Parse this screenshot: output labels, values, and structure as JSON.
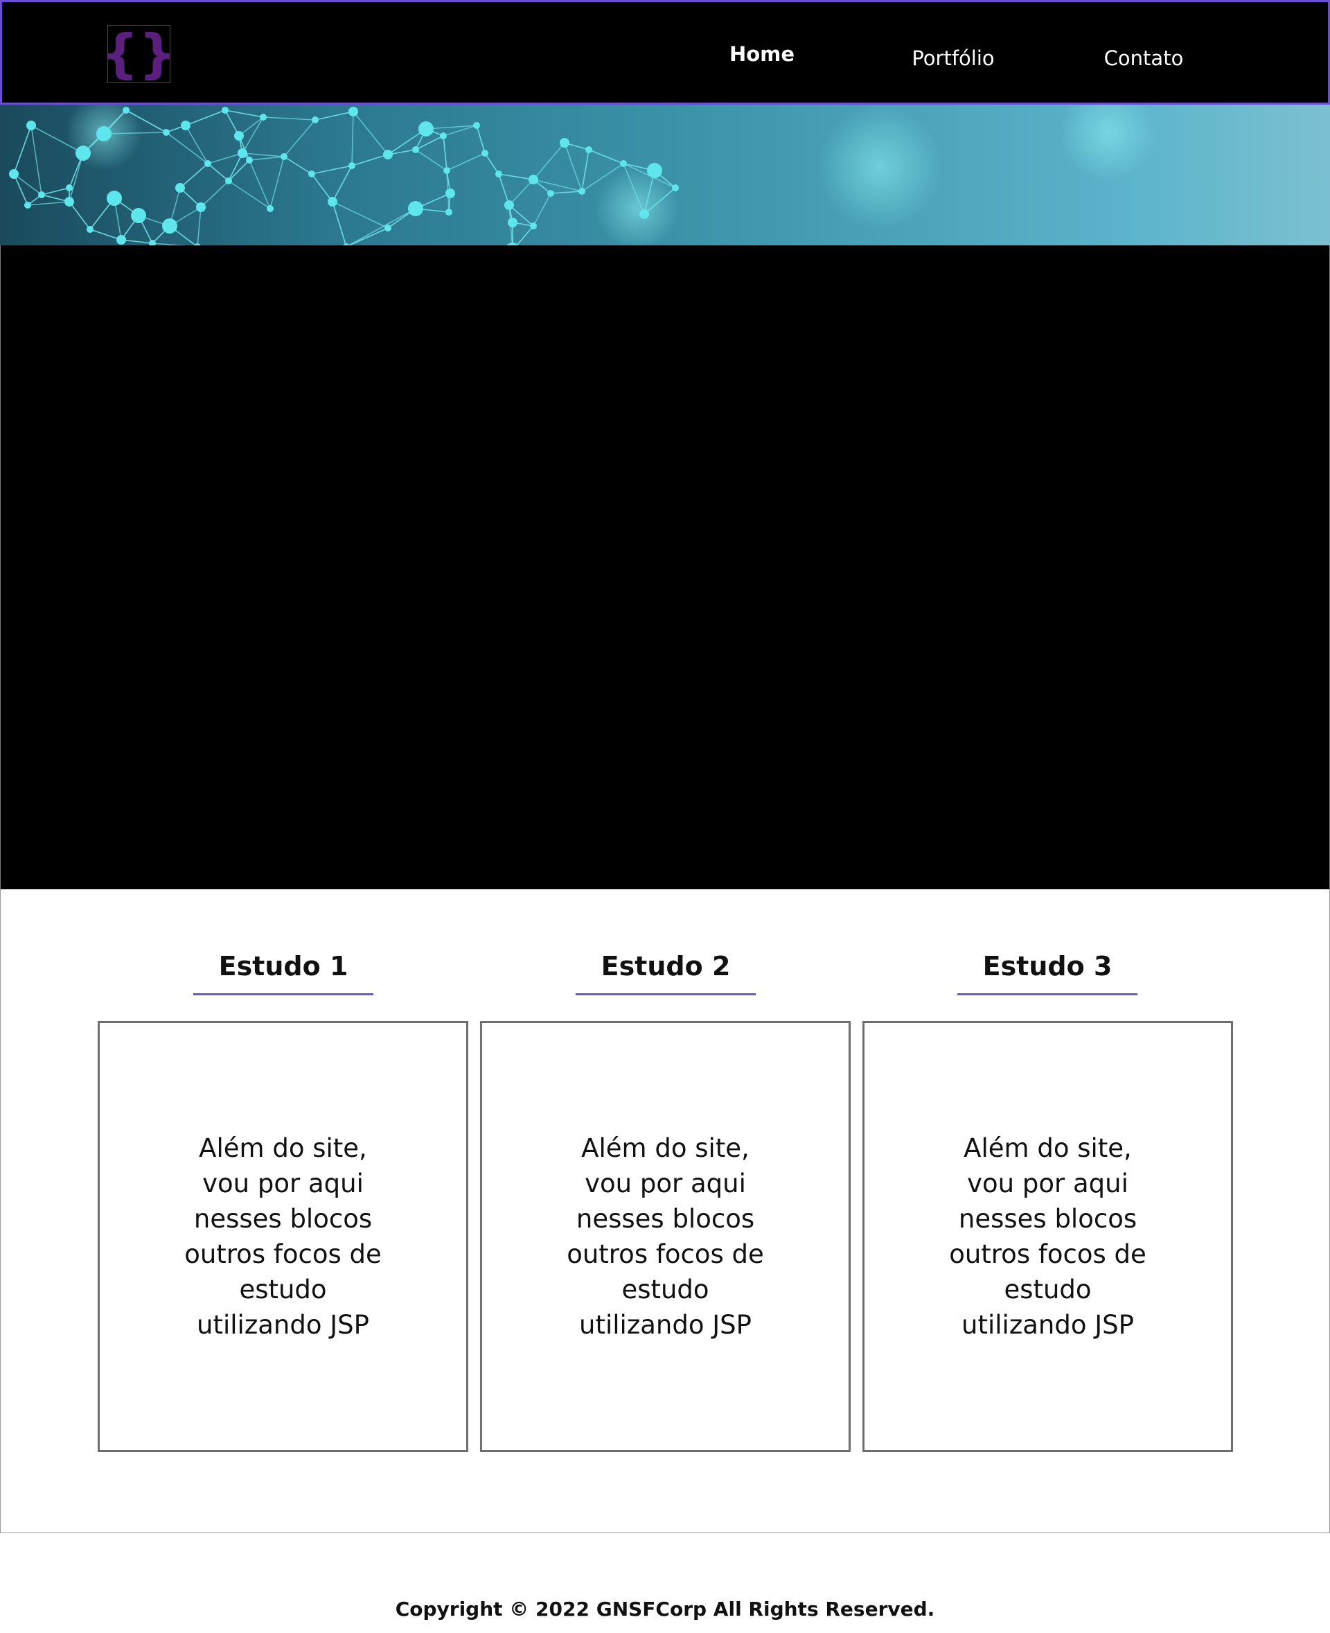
{
  "colors": {
    "accent": "#6a4fd2",
    "logo_brace": "#5b1f7e",
    "header_bg": "#000000",
    "banner_node": "#5fe6ec"
  },
  "logo": {
    "icon": "curly-braces-icon"
  },
  "nav": {
    "items": [
      {
        "label": "Home",
        "active": true
      },
      {
        "label": "Portfólio",
        "active": false
      },
      {
        "label": "Contato",
        "active": false
      }
    ]
  },
  "banner": {
    "image": "network-nodes-image"
  },
  "studies": [
    {
      "title": "Estudo 1",
      "lines": [
        "Além do site,",
        "vou por aqui",
        "nesses blocos",
        "outros focos de",
        "estudo",
        "utilizando JSP"
      ]
    },
    {
      "title": "Estudo 2",
      "lines": [
        "Além do site,",
        "vou por aqui",
        "nesses blocos",
        "outros focos de",
        "estudo",
        "utilizando JSP"
      ]
    },
    {
      "title": "Estudo 3",
      "lines": [
        "Além do site,",
        "vou por aqui",
        "nesses blocos",
        "outros focos de",
        "estudo",
        "utilizando JSP"
      ]
    }
  ],
  "footer": {
    "copyright": "Copyright © 2022 GNSFCorp All Rights Reserved."
  }
}
